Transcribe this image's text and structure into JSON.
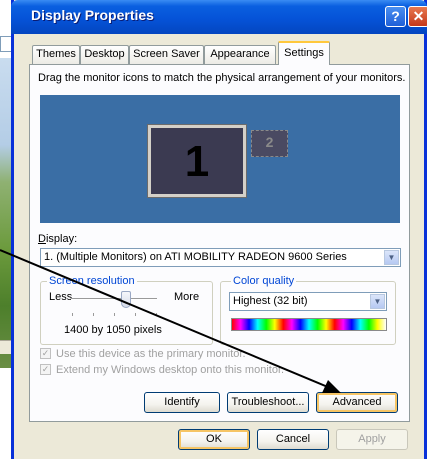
{
  "window": {
    "title": "Display Properties",
    "help_glyph": "?",
    "close_glyph": "✕"
  },
  "tabs": [
    {
      "label": "Themes"
    },
    {
      "label": "Desktop"
    },
    {
      "label": "Screen Saver"
    },
    {
      "label": "Appearance"
    },
    {
      "label": "Settings",
      "active": true
    }
  ],
  "settings": {
    "instruction": "Drag the monitor icons to match the physical arrangement of your monitors.",
    "monitors": [
      {
        "number": "1",
        "icon": "monitor-icon",
        "state": "active"
      },
      {
        "number": "2",
        "icon": "monitor-icon",
        "state": "inactive"
      }
    ],
    "display_label": "Display:",
    "display_value": "1. (Multiple Monitors) on ATI MOBILITY RADEON 9600 Series",
    "screen_resolution": {
      "group_label": "Screen resolution",
      "less_label": "Less",
      "more_label": "More",
      "value_text": "1400 by 1050 pixels",
      "slider_position": 0.58
    },
    "color_quality": {
      "group_label": "Color quality",
      "selected": "Highest (32 bit)"
    },
    "checkboxes": [
      {
        "label": "Use this device as the primary monitor.",
        "checked": true,
        "enabled": false
      },
      {
        "label": "Extend my Windows desktop onto this monitor.",
        "checked": true,
        "enabled": false
      }
    ],
    "buttons": {
      "identify": "Identify",
      "troubleshoot": "Troubleshoot...",
      "advanced": "Advanced"
    }
  },
  "footer": {
    "ok": "OK",
    "cancel": "Cancel",
    "apply": "Apply"
  },
  "colors": {
    "title_blue": "#0553d8",
    "dialog_face": "#ece9d8",
    "monitor_area": "#3a6ea5",
    "active_tab_accent": "#ffc83c",
    "group_label": "#0046d5"
  }
}
